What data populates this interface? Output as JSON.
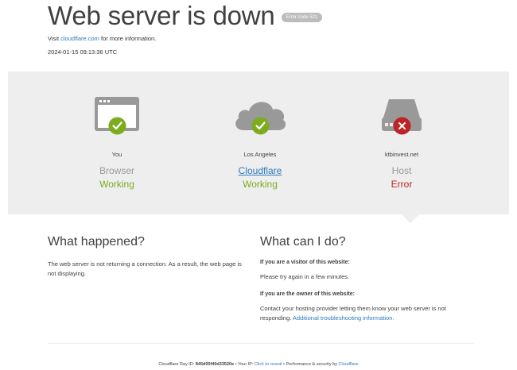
{
  "header": {
    "title": "Web server is down",
    "error_badge": "Error code 521",
    "visit_prefix": "Visit",
    "visit_link": "cloudflare.com",
    "visit_suffix": "for more information.",
    "timestamp": "2024-01-15 09:13:36 UTC"
  },
  "nodes": [
    {
      "location": "You",
      "name": "Browser",
      "status": "Working",
      "status_type": "ok",
      "icon": "browser-icon",
      "badge_icon": "checkmark-icon"
    },
    {
      "location": "Los Angeles",
      "name": "Cloudflare",
      "status": "Working",
      "status_type": "ok",
      "icon": "cloud-icon",
      "badge_icon": "checkmark-icon"
    },
    {
      "location": "ktbinvest.net",
      "name": "Host",
      "status": "Error",
      "status_type": "error",
      "icon": "server-icon",
      "badge_icon": "x-icon"
    }
  ],
  "what_happened": {
    "heading": "What happened?",
    "body": "The web server is not returning a connection. As a result, the web page is not displaying."
  },
  "what_can_i_do": {
    "heading": "What can I do?",
    "visitor_heading": "If you are a visitor of this website:",
    "visitor_body": "Please try again in a few minutes.",
    "owner_heading": "If you are the owner of this website:",
    "owner_body": "Contact your hosting provider letting them know your web server is not responding.",
    "owner_link": "Additional troubleshooting information."
  },
  "footer": {
    "ray_label": "Cloudflare Ray ID:",
    "ray_id": "845d00f40d33520e",
    "sep1": "•",
    "ip_label": "Your IP:",
    "ip_link": "Click to reveal",
    "sep2": "•",
    "perf_label": "Performance & security by",
    "perf_link": "Cloudflare"
  },
  "colors": {
    "ok_green": "#7dac1f",
    "error_red": "#bd2426",
    "link_blue": "#2f7bbf",
    "icon_gray": "#999999",
    "band_gray": "#eeeeee"
  }
}
